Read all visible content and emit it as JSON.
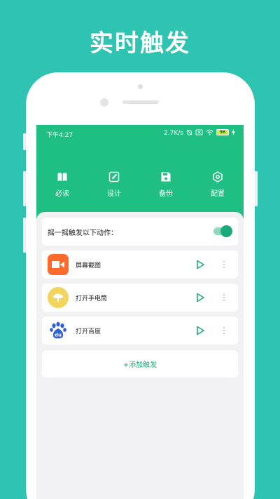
{
  "headline": "实时触发",
  "status_bar": {
    "time": "下午4:27",
    "network_speed": "2.7K/s",
    "battery_level": "96"
  },
  "nav": {
    "items": [
      {
        "label": "必读",
        "icon": "book-icon"
      },
      {
        "label": "设计",
        "icon": "edit-icon"
      },
      {
        "label": "备份",
        "icon": "save-icon"
      },
      {
        "label": "配置",
        "icon": "settings-icon"
      }
    ]
  },
  "shake": {
    "label": "摇一摇触发以下动作：",
    "enabled": true
  },
  "actions": [
    {
      "label": "屏幕截图",
      "icon": "screen-record-icon",
      "icon_color": "#ff6a2a"
    },
    {
      "label": "打开手电筒",
      "icon": "flashlight-icon",
      "icon_color": "#f3d45f"
    },
    {
      "label": "打开百度",
      "icon": "baidu-paw-icon",
      "icon_color": "#ffffff"
    }
  ],
  "add_trigger_label": "+添加触发",
  "colors": {
    "background": "#2fc4b2",
    "app_green": "#1fbe83",
    "accent": "#1fa97a"
  }
}
